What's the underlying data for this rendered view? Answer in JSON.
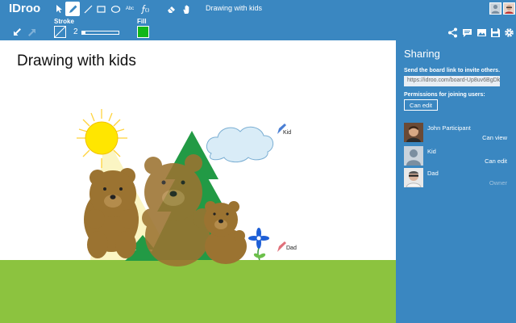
{
  "app": {
    "logo": "IDroo",
    "document_title": "Drawing with kids"
  },
  "toolbar": {
    "tools": [
      {
        "name": "select-tool",
        "icon": "cursor-icon",
        "active": false
      },
      {
        "name": "pencil-tool",
        "icon": "pencil-icon",
        "active": true
      },
      {
        "name": "line-tool",
        "icon": "line-icon",
        "active": false
      },
      {
        "name": "rectangle-tool",
        "icon": "rectangle-icon",
        "active": false
      },
      {
        "name": "ellipse-tool",
        "icon": "ellipse-icon",
        "active": false
      },
      {
        "name": "text-tool",
        "icon": "text-icon",
        "label": "Abc"
      },
      {
        "name": "formula-tool",
        "icon": "formula-icon",
        "label": "f(x)"
      },
      {
        "name": "eraser-tool",
        "icon": "eraser-icon"
      },
      {
        "name": "pan-tool",
        "icon": "hand-icon"
      }
    ],
    "stroke_label": "Stroke",
    "stroke_value": "2",
    "stroke_slider_level": 0.08,
    "fill_label": "Fill",
    "fill_color": "#11b71a",
    "undo_icon": "undo-arrow-icon",
    "redo_icon": "redo-arrow-icon",
    "right_icons": [
      "share-icon",
      "chat-icon",
      "image-icon",
      "save-icon",
      "settings-icon"
    ]
  },
  "canvas": {
    "title": "Drawing with kids",
    "cursors": [
      {
        "label": "Kid",
        "color": "#4a7fd4"
      },
      {
        "label": "Dad",
        "color": "#e0707a"
      }
    ],
    "colors": {
      "grass": "#8cc33f",
      "tree": "#229a45",
      "bear": "#9b7331",
      "sun": "#ffe600",
      "cloud": "#d9ecf7"
    }
  },
  "sidebar": {
    "title": "Sharing",
    "invite_text": "Send the board link to invite others.",
    "board_link": "https://idroo.com/board-Up8uv6BgDk",
    "permissions_label": "Permissions for joining users:",
    "permissions_button": "Can edit",
    "users": [
      {
        "name": "John Participant",
        "permission": "Can view",
        "avatar": "photo-avatar"
      },
      {
        "name": "Kid",
        "permission": "Can edit",
        "avatar": "default-avatar"
      },
      {
        "name": "Dad",
        "permission": "Owner",
        "avatar": "photo-avatar"
      }
    ]
  }
}
